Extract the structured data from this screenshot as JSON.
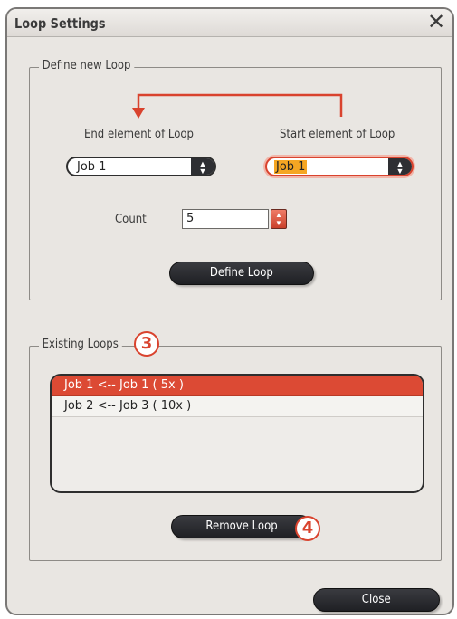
{
  "window": {
    "title": "Loop Settings",
    "close_glyph": "✕"
  },
  "define_group": {
    "legend": "Define new Loop",
    "end_label": "End element of Loop",
    "start_label": "Start element of Loop",
    "end_select_value": "Job 1",
    "start_select_value": "Job 1",
    "count_label": "Count",
    "count_value": "5",
    "define_button": "Define Loop",
    "arrow_color": "#d9432e"
  },
  "existing_group": {
    "legend": "Existing Loops",
    "badge": "3",
    "rows": [
      {
        "text": "Job 1 <-- Job 1 ( 5x )",
        "selected": true
      },
      {
        "text": "Job 2 <-- Job 3 ( 10x )",
        "selected": false
      }
    ],
    "remove_button": "Remove Loop",
    "remove_badge": "4"
  },
  "footer": {
    "close_button": "Close"
  },
  "colors": {
    "accent": "#d9432e",
    "selection": "#dc4a34",
    "button_dark": "#2e2f33",
    "dialog_bg": "#e9e6e2"
  }
}
